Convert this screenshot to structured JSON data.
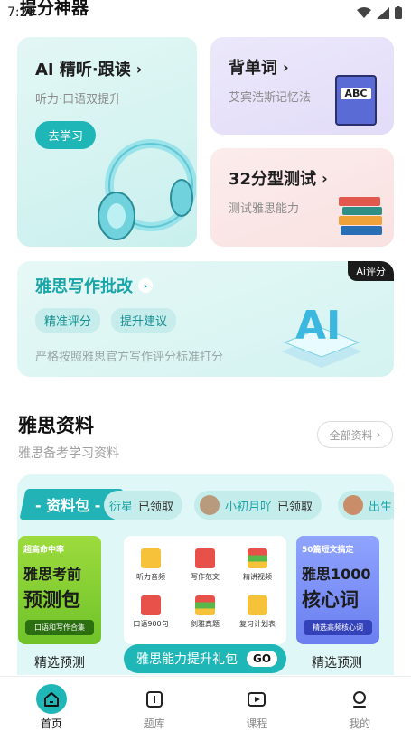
{
  "status_bar": {
    "time": "7:29"
  },
  "header": {
    "title": "提分神器"
  },
  "cards": {
    "ai_listen": {
      "title": "AI 精听·跟读",
      "subtitle": "听力·口语双提升",
      "button": "去学习"
    },
    "words": {
      "title": "背单词",
      "subtitle": "艾宾浩斯记忆法",
      "book_label": "ABC"
    },
    "test": {
      "title": "32分型测试",
      "subtitle": "测试雅思能力"
    },
    "writing": {
      "title": "雅思写作批改",
      "badge": "Ai评分",
      "tags": [
        "精准评分",
        "提升建议"
      ],
      "desc": "严格按照雅思官方写作评分标准打分"
    }
  },
  "resources": {
    "title": "雅思资料",
    "subtitle": "雅思备考学习资料",
    "all_button": "全部资料",
    "pack_label": "- 资料包 -",
    "claims": [
      {
        "user": "衍星",
        "action": "已领取"
      },
      {
        "user": "小初月吖",
        "action": "已领取"
      },
      {
        "user": "出生",
        "action": ""
      }
    ],
    "book_left": {
      "top": "超高命中率",
      "main": "雅思考前",
      "big": "预测包",
      "foot": "口语和写作合集",
      "caption": "精选预测"
    },
    "book_right": {
      "top": "50篇短文搞定",
      "main": "雅思1000",
      "big": "核心词",
      "foot": "精选高频核心词",
      "caption": "精选预测"
    },
    "grid": [
      "听力音频",
      "写作范文",
      "精讲视频",
      "口语900句",
      "剑雅真题",
      "复习计划表"
    ],
    "gift_button": "雅思能力提升礼包",
    "gift_go": "GO"
  },
  "tabbar": [
    {
      "label": "首页",
      "icon": "home-icon",
      "active": true
    },
    {
      "label": "题库",
      "icon": "book-icon",
      "active": false
    },
    {
      "label": "课程",
      "icon": "play-icon",
      "active": false
    },
    {
      "label": "我的",
      "icon": "profile-icon",
      "active": false
    }
  ],
  "colors": {
    "accent": "#1fb6b8",
    "accent_dark": "#1aa5a8"
  }
}
